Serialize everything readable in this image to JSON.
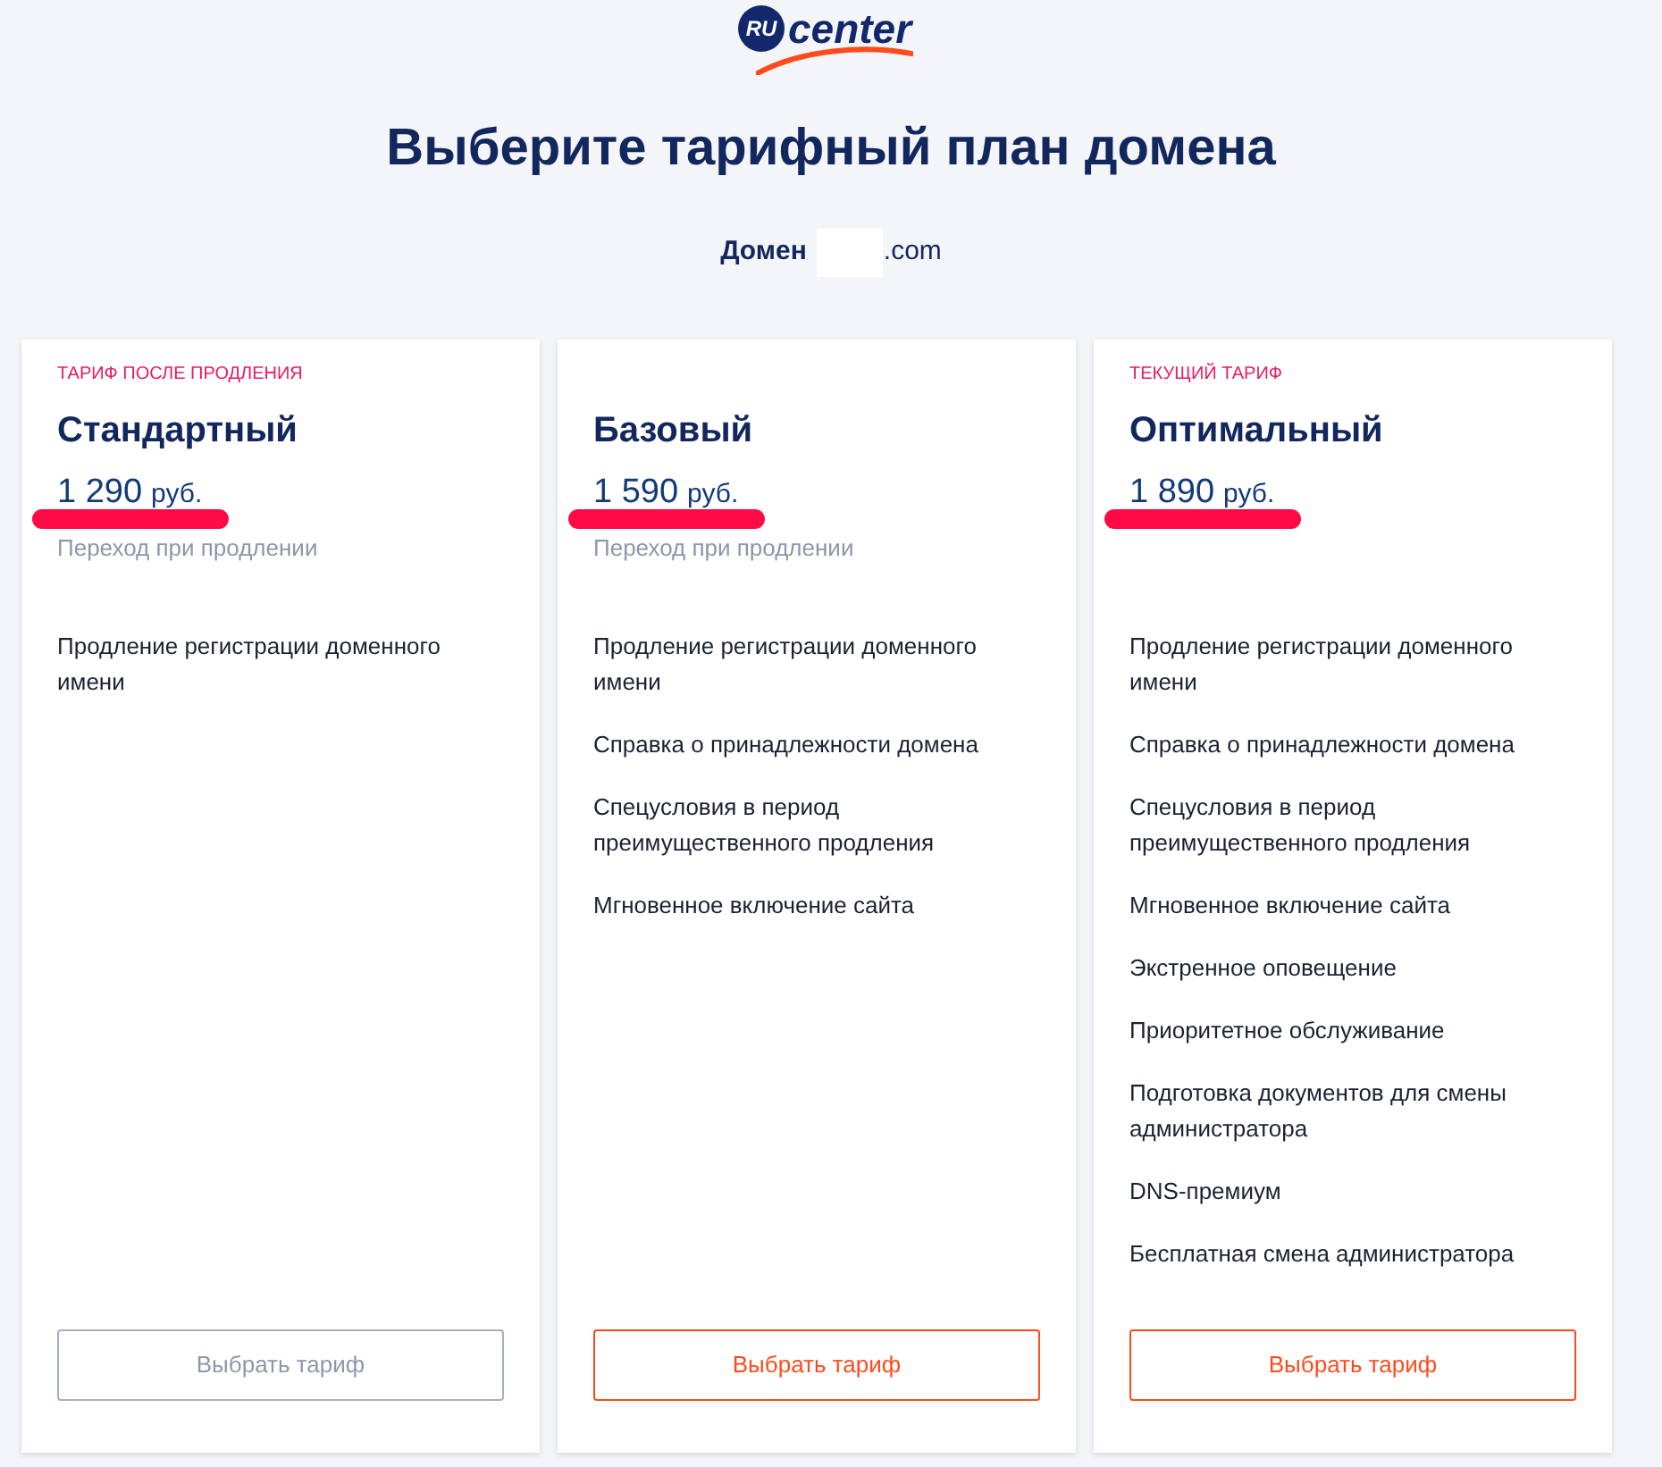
{
  "logo": {
    "badge": "RU",
    "text": "center"
  },
  "title": "Выберите тарифный план домена",
  "domain": {
    "label": "Домен",
    "redacted": true,
    "suffix": ".com"
  },
  "plans": [
    {
      "tag": "ТАРИФ ПОСЛЕ ПРОДЛЕНИЯ",
      "name": "Стандартный",
      "price": "1 290",
      "currency": "руб.",
      "underlined": true,
      "note": "Переход при продлении",
      "features": [
        "Продление регистрации доменного имени"
      ],
      "button": {
        "label": "Выбрать тариф",
        "disabled": true
      }
    },
    {
      "name": "Базовый",
      "price": "1 590",
      "currency": "руб.",
      "underlined": true,
      "note": "Переход при продлении",
      "features": [
        "Продление регистрации доменного имени",
        "Справка о принадлежности домена",
        "Спецусловия в период преимущественного продления",
        "Мгновенное включение сайта"
      ],
      "button": {
        "label": "Выбрать тариф",
        "disabled": false
      }
    },
    {
      "tag": "ТЕКУЩИЙ ТАРИФ",
      "name": "Оптимальный",
      "price": "1 890",
      "currency": "руб.",
      "underlined": true,
      "features": [
        "Продление регистрации доменного имени",
        "Справка о принадлежности домена",
        "Спецусловия в период преимущественного продления",
        "Мгновенное включение сайта",
        "Экстренное оповещение",
        "Приоритетное обслуживание",
        "Подготовка документов для смены администратора",
        "DNS-премиум",
        "Бесплатная смена администратора"
      ],
      "button": {
        "label": "Выбрать тариф",
        "disabled": false
      }
    }
  ]
}
